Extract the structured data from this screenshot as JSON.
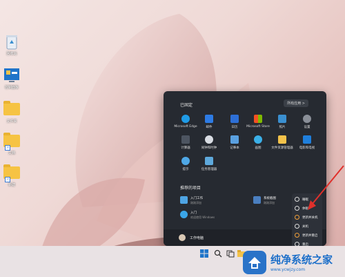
{
  "desktop": {
    "icons": [
      {
        "label": "回收站",
        "icon": "recycle-bin-icon"
      },
      {
        "label": "控制面板",
        "icon": "control-panel-icon"
      },
      {
        "label": "文件夹",
        "icon": "folder-icon"
      },
      {
        "label": "文档",
        "icon": "folder-shortcut-icon"
      },
      {
        "label": "新建",
        "icon": "folder-shortcut-icon"
      }
    ]
  },
  "start_menu": {
    "pinned_title": "已固定",
    "all_apps": "所有应用 >",
    "pinned": [
      {
        "label": "Microsoft Edge",
        "color": "#1f9be6"
      },
      {
        "label": "邮件",
        "color": "#2d7be4"
      },
      {
        "label": "日历",
        "color": "#2d6fd6"
      },
      {
        "label": "Microsoft Store",
        "color": "#f2f2f2"
      },
      {
        "label": "照片",
        "color": "#3a8fd0"
      },
      {
        "label": "设置",
        "color": "#8a8f98"
      },
      {
        "label": "计算器",
        "color": "#4d5561"
      },
      {
        "label": "闹钟和时钟",
        "color": "#d9dde3"
      },
      {
        "label": "记事本",
        "color": "#5aa0e0"
      },
      {
        "label": "画图",
        "color": "#3bb0e8"
      },
      {
        "label": "文件资源管理器",
        "color": "#f3c24a"
      },
      {
        "label": "电影和电视",
        "color": "#1f7fdc"
      },
      {
        "label": "提示",
        "color": "#4fa8e6"
      },
      {
        "label": "任务管理器",
        "color": "#5ea9dc"
      }
    ],
    "recommended_title": "推荐的项目",
    "recommended": [
      {
        "title": "入门工作",
        "sub": "刚刚添加",
        "color": "#4ea4e3"
      },
      {
        "title": "入门",
        "sub": "欢迎使用 Windows",
        "color": "#3aa6e8"
      },
      {
        "title": "系统截图",
        "sub": "刚刚添加",
        "color": "#4a7fc0"
      }
    ],
    "user_name": "工作电脑"
  },
  "power_menu": {
    "items": [
      "睡眠",
      "休眠",
      "更新并关机",
      "关机",
      "更新并重启",
      "重启"
    ]
  },
  "watermark": {
    "brand": "纯净系统之家",
    "url": "www.ycwjzy.com"
  }
}
